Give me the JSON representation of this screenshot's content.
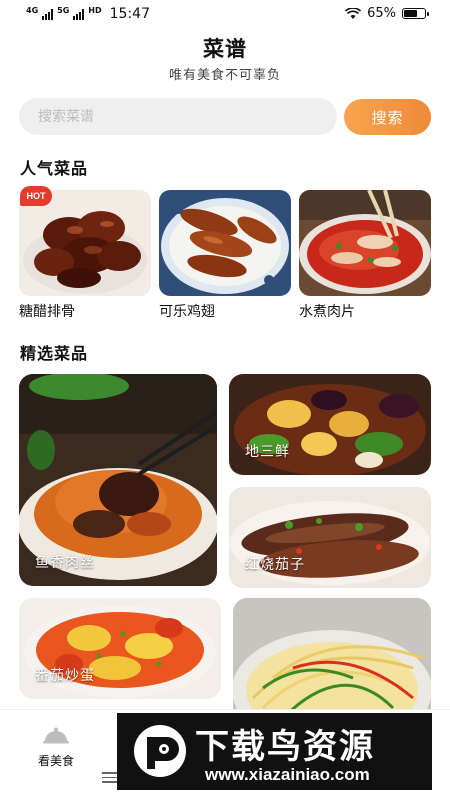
{
  "status_bar": {
    "network": "4G",
    "network2": "5G",
    "hd": "HD",
    "time": "15:47",
    "battery_percent": "65%",
    "battery_level": 0.65
  },
  "header": {
    "title": "菜谱",
    "subtitle": "唯有美食不可辜负"
  },
  "search": {
    "placeholder": "搜索菜谱",
    "button_label": "搜索"
  },
  "popular": {
    "section_title": "人气菜品",
    "badge": "HOT",
    "items": [
      {
        "name": "糖醋排骨"
      },
      {
        "name": "可乐鸡翅"
      },
      {
        "name": "水煮肉片"
      }
    ]
  },
  "featured": {
    "section_title": "精选菜品",
    "items": [
      {
        "name": "鱼香肉丝"
      },
      {
        "name": "地三鲜"
      },
      {
        "name": "红烧茄子"
      },
      {
        "name": "番茄炒蛋"
      },
      {
        "name": ""
      }
    ]
  },
  "bottom_nav": {
    "items": [
      {
        "label": "看美食",
        "icon": "cloche-icon"
      }
    ]
  },
  "watermark": {
    "title": "下载鸟资源",
    "url": "www.xiazainiao.com"
  }
}
